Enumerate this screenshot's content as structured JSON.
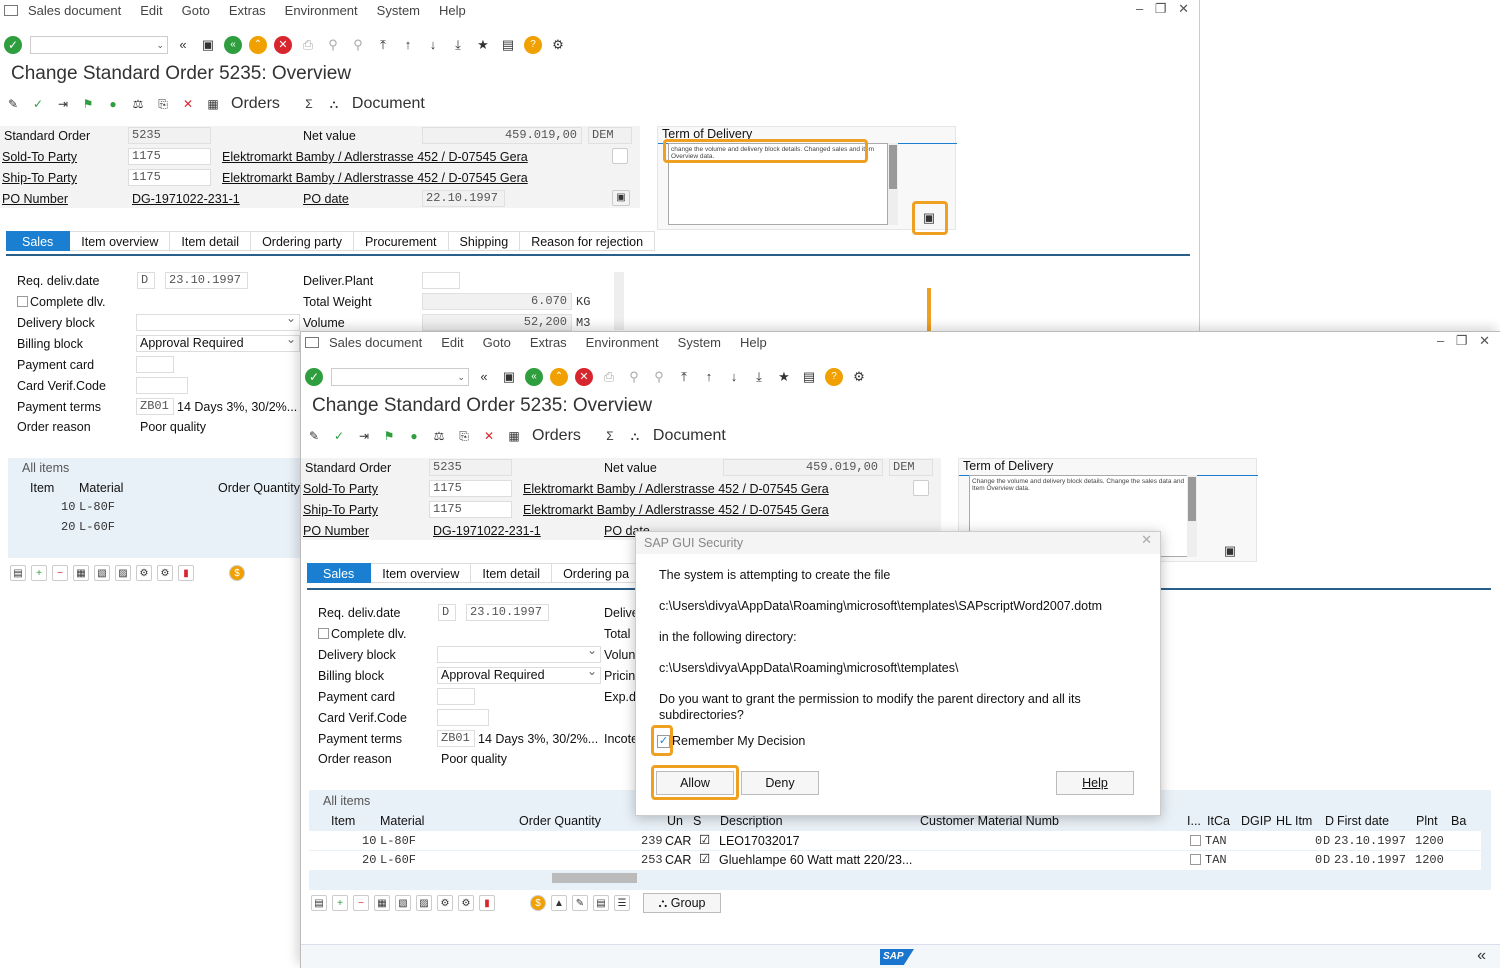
{
  "menu": [
    "Sales document",
    "Edit",
    "Goto",
    "Extras",
    "Environment",
    "System",
    "Help"
  ],
  "window_controls": "– ❐ ✕",
  "title": "Change Standard Order 5235: Overview",
  "apptoolbar": {
    "orders": "Orders",
    "document": "Document"
  },
  "header": {
    "standard_order_label": "Standard Order",
    "standard_order": "5235",
    "net_value_label": "Net value",
    "net_value": "459.019,00",
    "currency": "DEM",
    "sold_to_label": "Sold-To Party",
    "sold_to": "1175",
    "sold_to_addr": "Elektromarkt Bamby / Adlerstrasse 452 / D-07545 Gera",
    "ship_to_label": "Ship-To Party",
    "ship_to": "1175",
    "ship_to_addr": "Elektromarkt Bamby / Adlerstrasse 452 / D-07545 Gera",
    "po_number_label": "PO Number",
    "po_number": "DG-1971022-231-1",
    "po_date_label": "PO date",
    "po_date": "22.10.1997",
    "term_of_delivery_label": "Term of Delivery",
    "term_text_1": "change the volume and delivery block details. Changed sales and item Overview data.",
    "term_text_2": "Change the volume and delivery block details. Change the sales data and Item Overview data."
  },
  "tabs": [
    "Sales",
    "Item overview",
    "Item detail",
    "Ordering party",
    "Procurement",
    "Shipping",
    "Reason for rejection"
  ],
  "tabs_w2": [
    "Sales",
    "Item overview",
    "Item detail",
    "Ordering pa"
  ],
  "sales": {
    "req_deliv_label": "Req. deliv.date",
    "req_deliv_unit": "D",
    "req_deliv": "23.10.1997",
    "complete_dlv": "Complete dlv.",
    "delivery_block": "Delivery block",
    "billing_block": "Billing block",
    "billing_block_val": "Approval Required",
    "payment_card": "Payment card",
    "card_verif": "Card Verif.Code",
    "payment_terms": "Payment terms",
    "payment_terms_code": "ZB01",
    "payment_terms_text": "14 Days 3%, 30/2%...",
    "order_reason": "Order reason",
    "order_reason_val": "Poor quality",
    "deliver_plant": "Deliver.Plant",
    "total_weight": "Total Weight",
    "total_weight_val": "6.070",
    "weight_unit": "KG",
    "volume": "Volume",
    "volume_val": "52,200",
    "volume_unit": "M3",
    "w2_right_labels": [
      "Delive",
      "Total",
      "Volun",
      "Pricin",
      "Exp.d",
      "Incote"
    ]
  },
  "items": {
    "all_items": "All items",
    "cols": [
      "Item",
      "Material",
      "Order Quantity",
      "Un",
      "S",
      "Description",
      "Customer Material Numb",
      "I...",
      "ItCa",
      "DGIP",
      "HL Itm",
      "D",
      "First date",
      "Plnt",
      "Ba"
    ],
    "rows": [
      {
        "item": "10",
        "material": "L-80F",
        "qty": "239",
        "un": "CAR",
        "desc": "LEO17032017",
        "itca": "TAN",
        "d": "D",
        "date": "23.10.1997",
        "plnt": "1200"
      },
      {
        "item": "20",
        "material": "L-60F",
        "qty": "253",
        "un": "CAR",
        "desc": "Gluehlampe 60 Watt matt 220/23...",
        "itca": "TAN",
        "d": "D",
        "date": "23.10.1997",
        "plnt": "1200"
      }
    ],
    "zero": "0",
    "group": "Group"
  },
  "dialog": {
    "title": "SAP GUI Security",
    "line1": "The system is attempting to create the file",
    "path1": "c:\\Users\\divya\\AppData\\Roaming\\microsoft\\templates\\SAPscriptWord2007.dotm",
    "line2": "in the following directory:",
    "path2": "c:\\Users\\divya\\AppData\\Roaming\\microsoft\\templates\\",
    "line3a": "Do you want to grant the permission to modify the parent directory and all its",
    "line3b": "subdirectories?",
    "remember": "Remember My Decision",
    "allow": "Allow",
    "deny": "Deny",
    "help": "Help"
  },
  "highlight_color": "#f0a020",
  "accent": "#1a7fd0"
}
